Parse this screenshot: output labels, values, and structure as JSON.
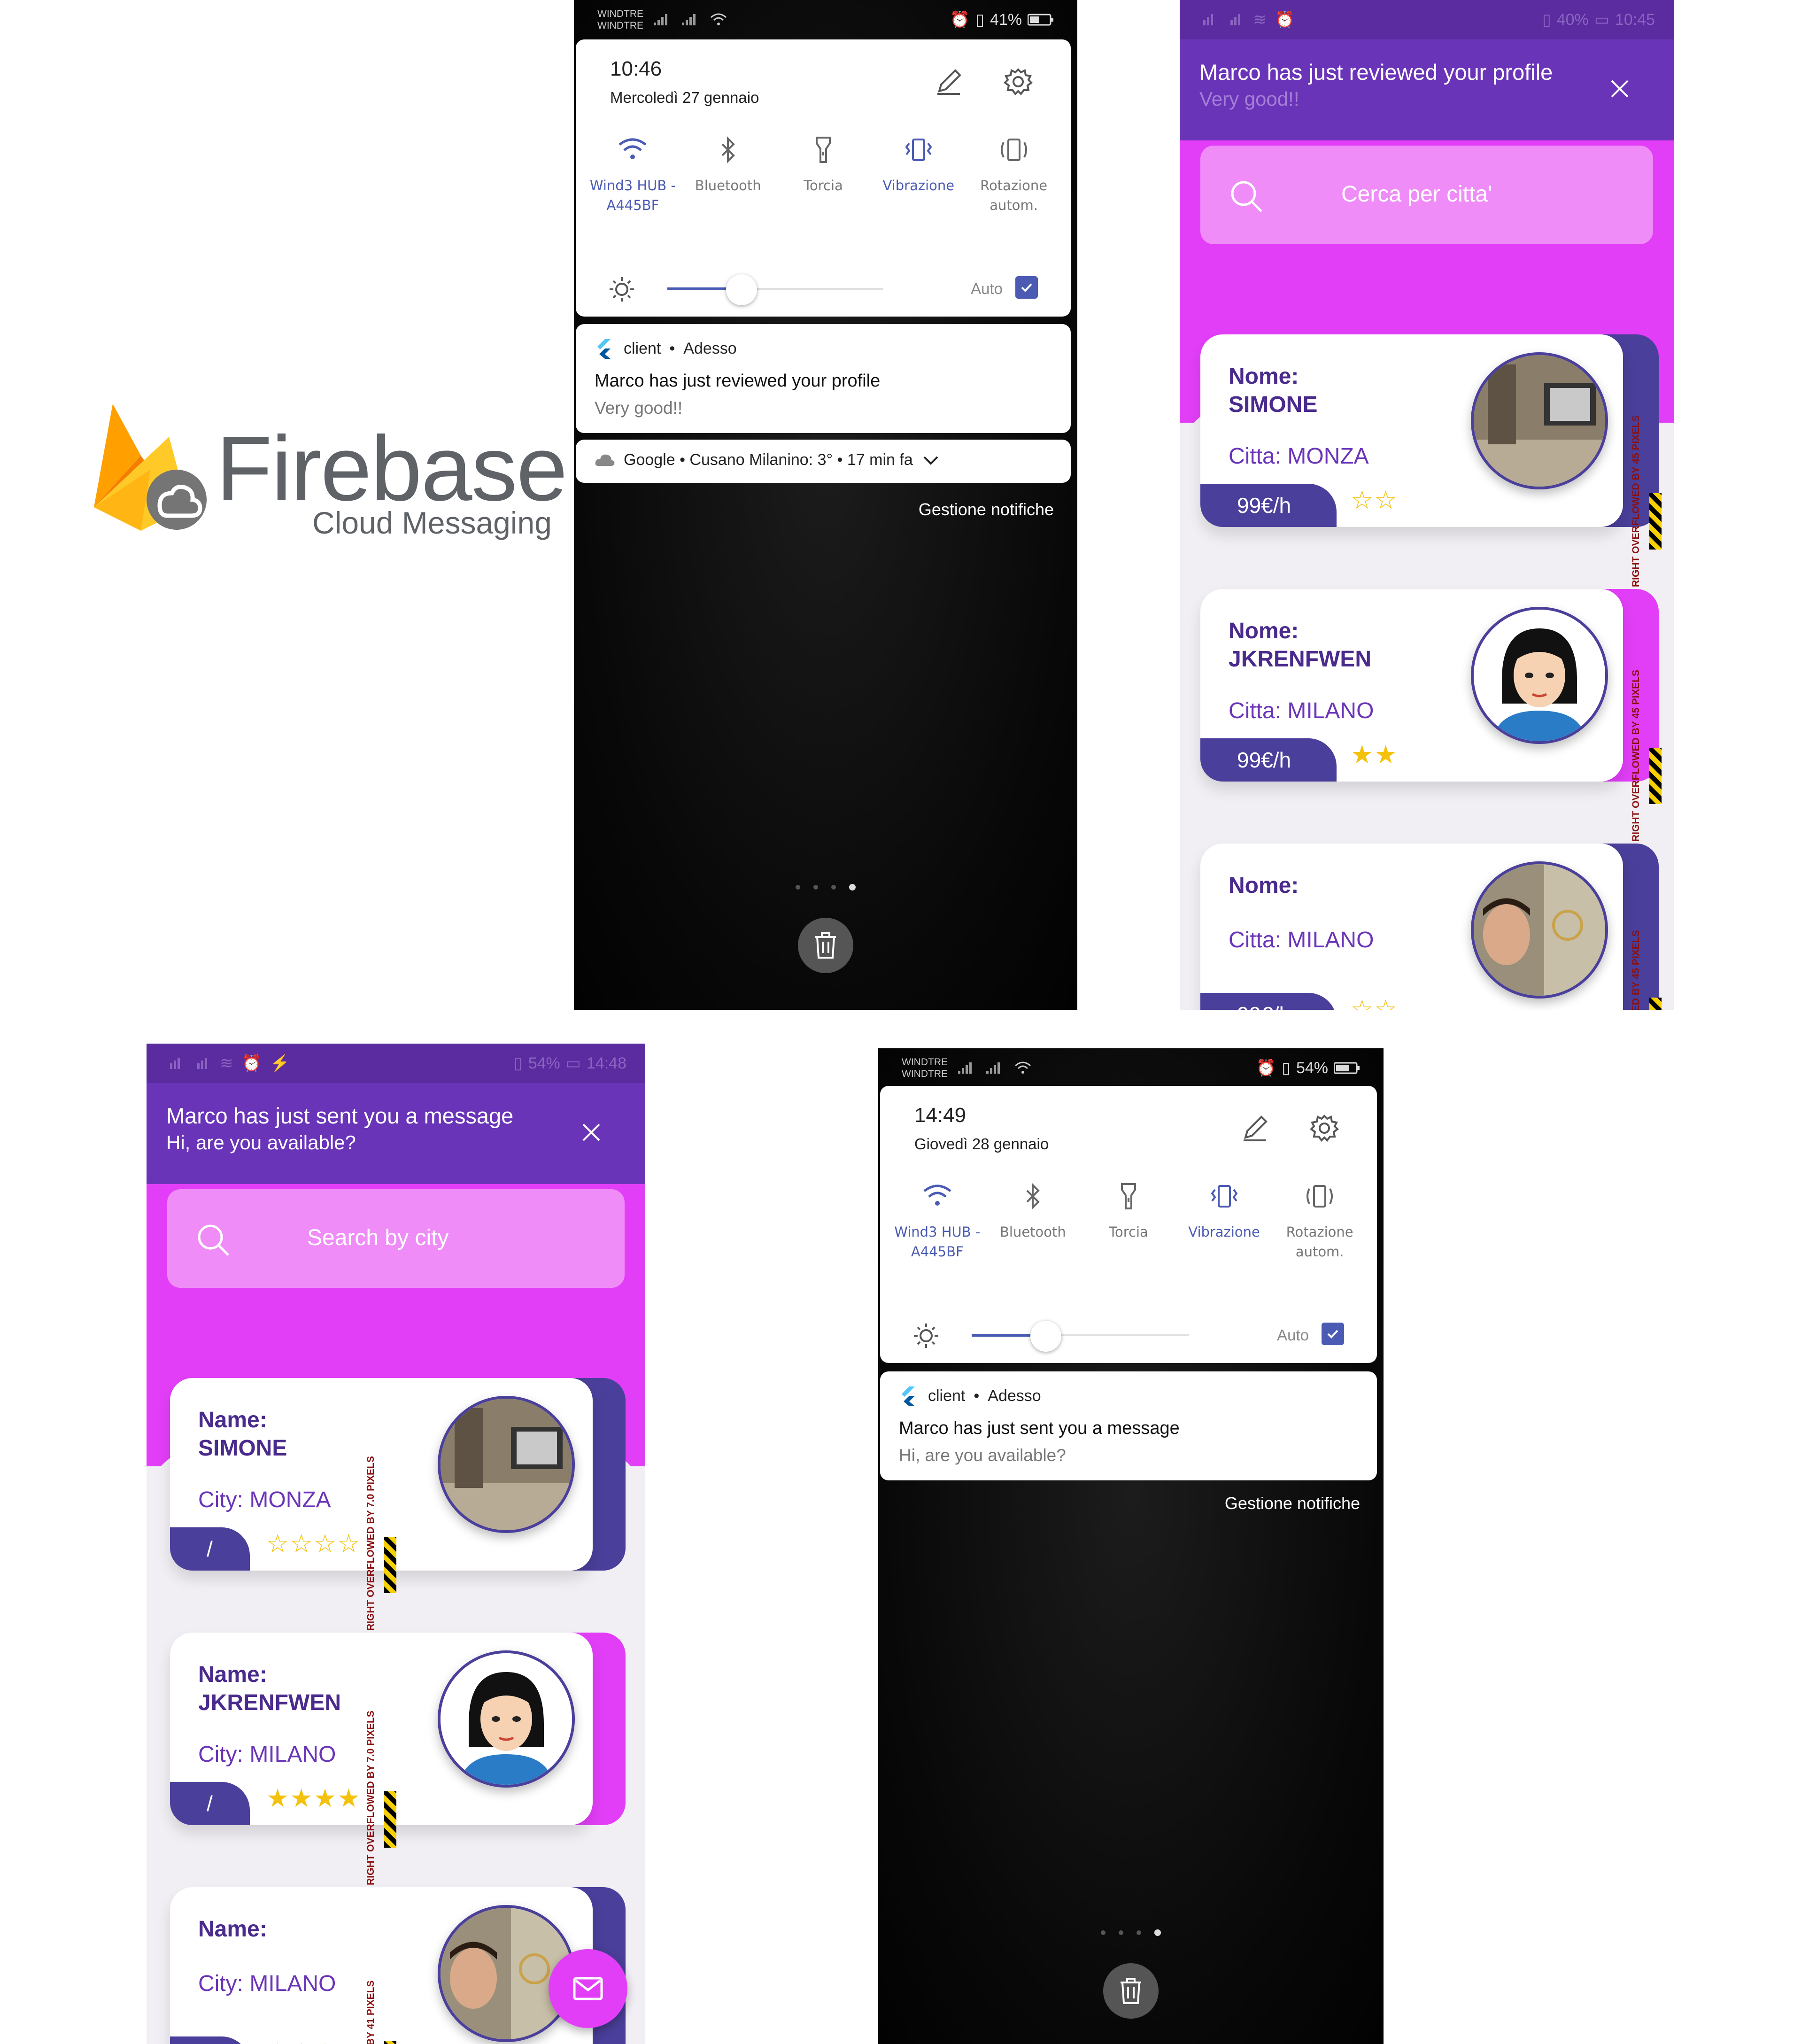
{
  "logo": {
    "name": "Firebase",
    "subtitle": "Cloud Messaging"
  },
  "phone1": {
    "carrier": [
      "WINDTRE",
      "WINDTRE"
    ],
    "status_right": "41%",
    "time": "10:46",
    "date": "Mercoledì 27 gennaio",
    "tiles": [
      {
        "label": "Wind3 HUB -\nA445BF",
        "icon": "wifi-icon",
        "active": true
      },
      {
        "label": "Bluetooth",
        "icon": "bluetooth-icon",
        "active": false
      },
      {
        "label": "Torcia",
        "icon": "flashlight-icon",
        "active": false
      },
      {
        "label": "Vibrazione",
        "icon": "vibrate-icon",
        "active": true
      },
      {
        "label": "Rotazione\nautom.",
        "icon": "rotate-icon",
        "active": false
      }
    ],
    "auto_label": "Auto",
    "notif_app": "client",
    "notif_time": "Adesso",
    "notif_title": "Marco has just reviewed your profile",
    "notif_body": "Very good!!",
    "weather": "Google • Cusano Milanino: 3° • 17 min fa",
    "manage": "Gestione notifiche"
  },
  "phone2": {
    "status_right": "40%",
    "status_time": "10:45",
    "banner_title": "Marco has just reviewed your profile",
    "banner_body": "Very good!!",
    "search_placeholder": "Cerca per citta'",
    "cards": [
      {
        "name_label": "Nome:",
        "name": "SIMONE",
        "city": "Citta: MONZA",
        "price": "99€/h",
        "stars": "☆☆",
        "overflow": "RIGHT OVERFLOWED BY 45 PIXELS",
        "back_color": "#4a3f9a"
      },
      {
        "name_label": "Nome:",
        "name": "JKRENFWEN",
        "city": "Citta: MILANO",
        "price": "99€/h",
        "stars": "★★",
        "overflow": "RIGHT OVERFLOWED BY 45 PIXELS",
        "back_color": "#e23ef8"
      },
      {
        "name_label": "Nome:",
        "name": "",
        "city": "Citta: MILANO",
        "price": "99€/h",
        "stars": "☆☆",
        "overflow": "ED BY 45 PIXELS",
        "back_color": "#4a3f9a"
      }
    ]
  },
  "phone3": {
    "status_right": "54%",
    "status_time": "14:48",
    "banner_title": "Marco has just sent you a message",
    "banner_body": "Hi, are you available?",
    "search_placeholder": "Search by city",
    "cards": [
      {
        "name_label": "Name:",
        "name": "SIMONE",
        "city": "City: MONZA",
        "price": "/",
        "stars": "☆☆☆☆",
        "overflow": "RIGHT OVERFLOWED BY 7.0 PIXELS",
        "back_color": "#4a3f9a"
      },
      {
        "name_label": "Name:",
        "name": "JKRENFWEN",
        "city": "City: MILANO",
        "price": "/",
        "stars": "★★★★",
        "overflow": "RIGHT OVERFLOWED BY 7.0 PIXELS",
        "back_color": "#e23ef8"
      },
      {
        "name_label": "Name:",
        "name": "",
        "city": "City: MILANO",
        "price": "/",
        "stars": "★★★",
        "overflow": "D BY 41 PIXELS",
        "back_color": "#4a3f9a"
      }
    ]
  },
  "phone4": {
    "carrier": [
      "WINDTRE",
      "WINDTRE"
    ],
    "status_right": "54%",
    "time": "14:49",
    "date": "Giovedì 28 gennaio",
    "tiles": [
      {
        "label": "Wind3 HUB -\nA445BF",
        "icon": "wifi-icon",
        "active": true
      },
      {
        "label": "Bluetooth",
        "icon": "bluetooth-icon",
        "active": false
      },
      {
        "label": "Torcia",
        "icon": "flashlight-icon",
        "active": false
      },
      {
        "label": "Vibrazione",
        "icon": "vibrate-icon",
        "active": true
      },
      {
        "label": "Rotazione\nautom.",
        "icon": "rotate-icon",
        "active": false
      }
    ],
    "auto_label": "Auto",
    "notif_app": "client",
    "notif_time": "Adesso",
    "notif_title": "Marco has just sent you a message",
    "notif_body": "Hi, are you available?",
    "manage": "Gestione notifiche"
  },
  "colors": {
    "purple": "#6a34b8",
    "dark_purple": "#4a3f9a",
    "pink": "#e23ef8",
    "light_pink": "#ef8cf8",
    "star": "#f4c20d"
  }
}
